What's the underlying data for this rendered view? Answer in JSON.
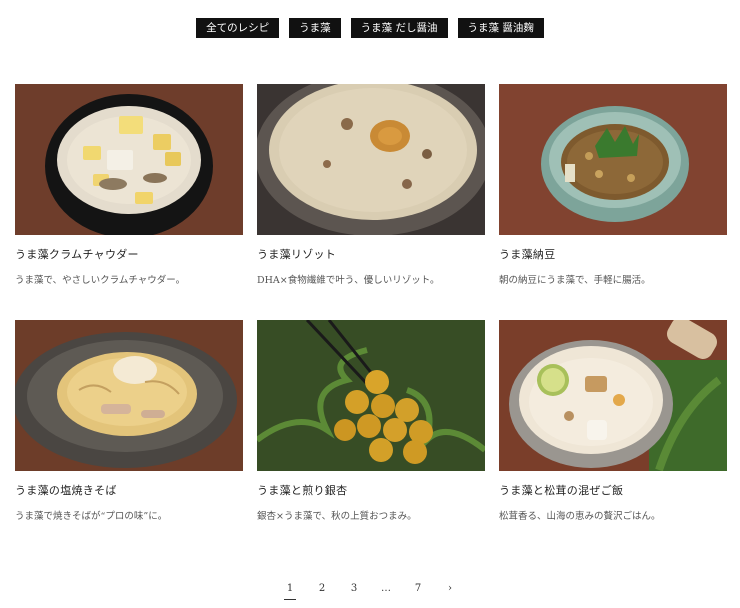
{
  "filters": [
    {
      "label": "全てのレシピ"
    },
    {
      "label": "うま藻"
    },
    {
      "label": "うま藻 だし醤油"
    },
    {
      "label": "うま藻 醤油麹"
    }
  ],
  "recipes": [
    {
      "title": "うま藻クラムチャウダー",
      "desc": "うま藻で、やさしいクラムチャウダー。",
      "image": "clam-chowder-photo"
    },
    {
      "title": "うま藻リゾット",
      "desc": "DHA×食物繊維で叶う、優しいリゾット。",
      "image": "risotto-photo"
    },
    {
      "title": "うま藻納豆",
      "desc": "朝の納豆にうま藻で、手軽に腸活。",
      "image": "natto-photo"
    },
    {
      "title": "うま藻の塩焼きそば",
      "desc": "うま藻で焼きそばが“プロの味”に。",
      "image": "shio-yakisoba-photo"
    },
    {
      "title": "うま藻と煎り銀杏",
      "desc": "銀杏×うま藻で、秋の上質おつまみ。",
      "image": "ginkgo-photo"
    },
    {
      "title": "うま藻と松茸の混ぜご飯",
      "desc": "松茸香る、山海の恵みの贅沢ごはん。",
      "image": "matsutake-rice-photo"
    }
  ],
  "pagination": {
    "pages": [
      "1",
      "2",
      "3",
      "…",
      "7",
      "›"
    ],
    "current": "1"
  },
  "colors": {
    "filter_bg": "#111111",
    "filter_text": "#ffffff",
    "wood": "#6b3f2a"
  }
}
